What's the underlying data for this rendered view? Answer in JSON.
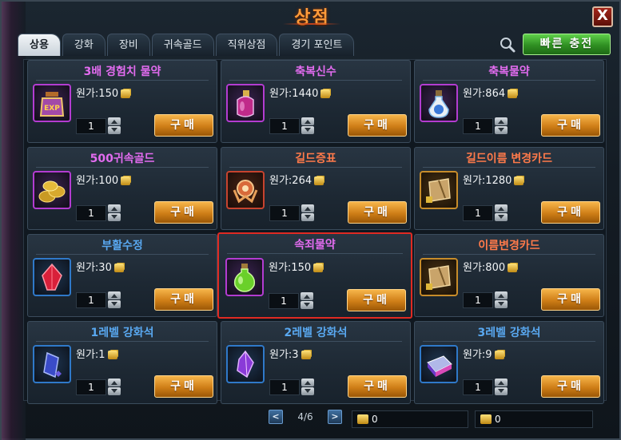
{
  "window": {
    "title": "상점",
    "close_label": "X"
  },
  "tabs": [
    {
      "label": "상용"
    },
    {
      "label": "강화"
    },
    {
      "label": "장비"
    },
    {
      "label": "귀속골드"
    },
    {
      "label": "직위상점"
    },
    {
      "label": "경기 포인트"
    }
  ],
  "quick_charge_label": "빠른 충전",
  "buy_label": "구매",
  "items": [
    {
      "name": "3배 경험치 물약",
      "price": "원가:150",
      "qty": "1",
      "icon": "exp-potion-icon",
      "color": "#e36cf0"
    },
    {
      "name": "축복신수",
      "price": "원가:1440",
      "qty": "1",
      "icon": "blessing-bottle-icon",
      "color": "#e36cf0"
    },
    {
      "name": "축복물약",
      "price": "원가:864",
      "qty": "1",
      "icon": "blessing-potion-icon",
      "color": "#e36cf0"
    },
    {
      "name": "500귀속골드",
      "price": "원가:100",
      "qty": "1",
      "icon": "gold-coins-icon",
      "color": "#e36cf0"
    },
    {
      "name": "길드증표",
      "price": "원가:264",
      "qty": "1",
      "icon": "guild-emblem-icon",
      "color": "#ff7a4a"
    },
    {
      "name": "길드이름 변경카드",
      "price": "원가:1280",
      "qty": "1",
      "icon": "guild-rename-scroll-icon",
      "color": "#ff7a4a"
    },
    {
      "name": "부활수정",
      "price": "원가:30",
      "qty": "1",
      "icon": "revive-crystal-icon",
      "color": "#59a8f0"
    },
    {
      "name": "속죄물약",
      "price": "원가:150",
      "qty": "1",
      "icon": "atonement-potion-icon",
      "color": "#e36cf0"
    },
    {
      "name": "이름변경카드",
      "price": "원가:800",
      "qty": "1",
      "icon": "rename-scroll-icon",
      "color": "#ff7a4a"
    },
    {
      "name": "1레벨 강화석",
      "price": "원가:1",
      "qty": "1",
      "icon": "enhance-stone-1-icon",
      "color": "#59a8f0"
    },
    {
      "name": "2레벨 강화석",
      "price": "원가:3",
      "qty": "1",
      "icon": "enhance-stone-2-icon",
      "color": "#59a8f0"
    },
    {
      "name": "3레벨 강화석",
      "price": "원가:9",
      "qty": "1",
      "icon": "enhance-stone-3-icon",
      "color": "#59a8f0"
    }
  ],
  "selected_item_index": 7,
  "pager": {
    "text": "4/6",
    "prev": "<",
    "next": ">"
  },
  "balances": {
    "gold": "0",
    "bound_gold": "0"
  }
}
